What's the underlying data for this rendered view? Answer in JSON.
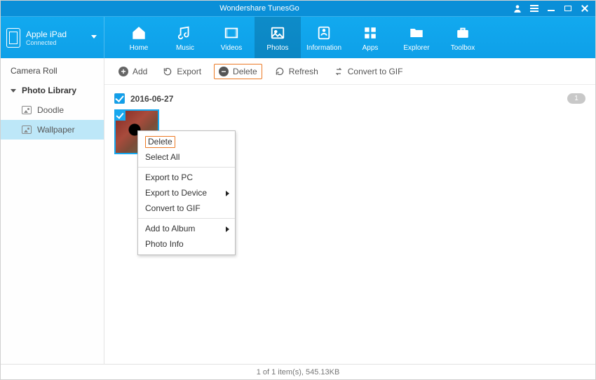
{
  "titlebar": {
    "app_title": "Wondershare TunesGo"
  },
  "device": {
    "name": "Apple iPad",
    "status": "Connected"
  },
  "nav": {
    "items": [
      {
        "label": "Home"
      },
      {
        "label": "Music"
      },
      {
        "label": "Videos"
      },
      {
        "label": "Photos"
      },
      {
        "label": "Information"
      },
      {
        "label": "Apps"
      },
      {
        "label": "Explorer"
      },
      {
        "label": "Toolbox"
      }
    ],
    "active_index": 3
  },
  "sidebar": {
    "items": [
      {
        "label": "Camera Roll"
      },
      {
        "label": "Photo Library"
      },
      {
        "label": "Doodle"
      },
      {
        "label": "Wallpaper"
      }
    ],
    "active_index": 3
  },
  "toolbar": {
    "add_label": "Add",
    "export_label": "Export",
    "delete_label": "Delete",
    "refresh_label": "Refresh",
    "convertgif_label": "Convert to GIF"
  },
  "photo_group": {
    "date_label": "2016-06-27",
    "count_badge": "1"
  },
  "context_menu": {
    "items": [
      {
        "label": "Delete",
        "highlighted": true
      },
      {
        "label": "Select All"
      },
      {
        "sep": true
      },
      {
        "label": "Export to PC"
      },
      {
        "label": "Export to Device",
        "submenu": true
      },
      {
        "label": "Convert to GIF"
      },
      {
        "sep": true
      },
      {
        "label": "Add to Album",
        "submenu": true
      },
      {
        "label": "Photo Info"
      }
    ]
  },
  "statusbar": {
    "text": "1 of 1 item(s), 545.13KB"
  }
}
